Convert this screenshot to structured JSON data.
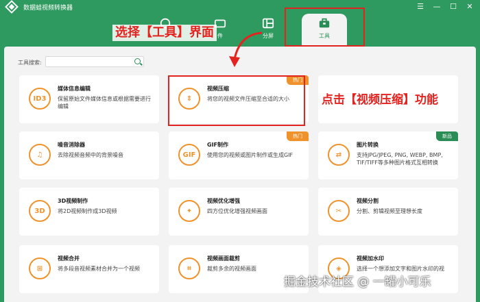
{
  "window": {
    "title": "数据蛙视频转换器",
    "buttons": [
      "☰",
      "—",
      "☐",
      "✕"
    ]
  },
  "nav": {
    "tabs": [
      {
        "label": "",
        "icon": "refresh-icon"
      },
      {
        "label": "件",
        "icon": "tv-icon"
      },
      {
        "label": "分屏",
        "icon": "split-screen-icon"
      },
      {
        "label": "工具",
        "icon": "toolbox-icon",
        "active": true
      }
    ]
  },
  "annotations": {
    "select_tools": "选择【工具】界面",
    "click_compress": "点击【视频压缩】功能"
  },
  "search": {
    "label": "工具搜索:",
    "placeholder": ""
  },
  "cards": [
    {
      "title": "媒体信息编辑",
      "desc": "保留原始文件媒体信息或根据需要进行编辑",
      "icon": "ID3",
      "badge": ""
    },
    {
      "title": "视频压缩",
      "desc": "将您的视频文件压缩至合适的大小",
      "icon": "⇕",
      "badge": "热门"
    },
    {
      "title": "",
      "desc": "",
      "icon": "",
      "badge": ""
    },
    {
      "title": "噪音消除器",
      "desc": "去除视频音频中的背景噪音",
      "icon": "♫",
      "badge": ""
    },
    {
      "title": "GIF制作",
      "desc": "使用您的视频或图片制作或生成GIF",
      "icon": "GIF",
      "badge": "热门"
    },
    {
      "title": "图片转换",
      "desc": "支持JPG/JPEG, PNG, WEBP, BMP, TIF/TIFF等多种图片格式互相转换",
      "icon": "⇄",
      "badge": "新品"
    },
    {
      "title": "3D视频制作",
      "desc": "将2D视频制作成3D视频",
      "icon": "3D",
      "badge": ""
    },
    {
      "title": "视频优化增强",
      "desc": "四方位优化增强视频画面",
      "icon": "✦",
      "badge": ""
    },
    {
      "title": "视频分割",
      "desc": "分割、剪辑视频至理想长度",
      "icon": "✂",
      "badge": ""
    },
    {
      "title": "视频合并",
      "desc": "将多段音视频素材合并为一个视频",
      "icon": "⊞",
      "badge": ""
    },
    {
      "title": "视频画面裁剪",
      "desc": "裁剪多余的视频画面",
      "icon": "⌗",
      "badge": ""
    },
    {
      "title": "视频加水印",
      "desc": "选择一个想添加文字和图片水印的视",
      "icon": "◈",
      "badge": ""
    }
  ],
  "watermark": "掘金技术社区 @ 一罐小可乐",
  "colors": {
    "brand": "#2f9a5f",
    "accent": "#f0922b",
    "annotation": "#e3231f",
    "new_badge": "#2a8d55"
  }
}
